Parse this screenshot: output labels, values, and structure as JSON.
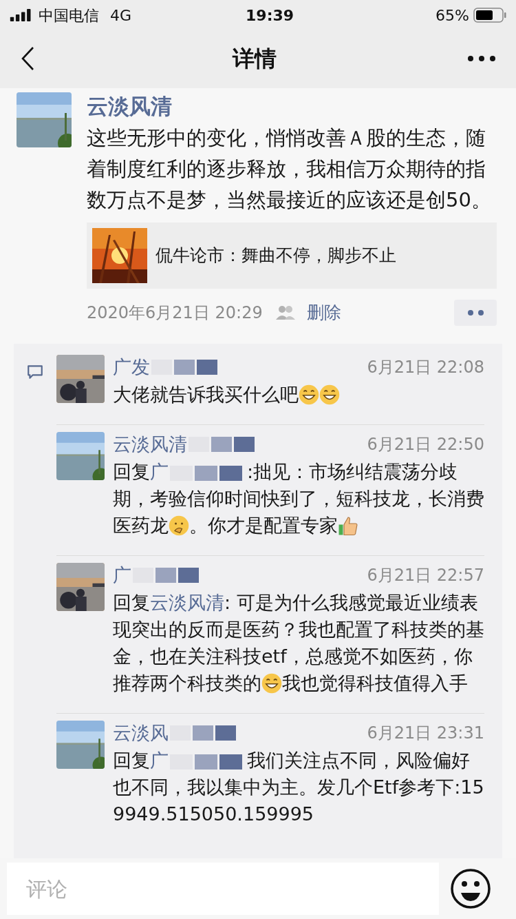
{
  "status_bar": {
    "carrier": "中国电信",
    "network": "4G",
    "time": "19:39",
    "battery": "65%"
  },
  "nav": {
    "title": "详情"
  },
  "post": {
    "author": "云淡风清",
    "text": "这些无形中的变化，悄悄改善Ａ股的生态，随着制度红利的逐步释放，我相信万众期待的指数万点不是梦，当然最接近的应该还是创50。",
    "link": {
      "title": "侃牛论市：舞曲不停，脚步不止"
    },
    "time": "2020年6月21日 20:29",
    "delete": "删除"
  },
  "comments": [
    {
      "author": "广发",
      "redacted": true,
      "time": "6月21日 22:08",
      "segments": [
        {
          "kind": "text",
          "text": "大佬就告诉我买什么吧"
        },
        {
          "kind": "grin"
        },
        {
          "kind": "grin"
        }
      ]
    },
    {
      "author": "云淡风清",
      "redacted": true,
      "time": "6月21日 22:50",
      "reply_label": "回复",
      "reply_to": "广",
      "reply_redacted": true,
      "segments": [
        {
          "kind": "text",
          "text": ":拙见：市场纠结震荡分歧期，考验信仰时间快到了，短科技龙，长消费医药龙"
        },
        {
          "kind": "thinking"
        },
        {
          "kind": "text",
          "text": "。你才是配置专家"
        },
        {
          "kind": "thumbs"
        }
      ]
    },
    {
      "author": "广",
      "redacted": true,
      "time": "6月21日 22:57",
      "reply_label": "回复",
      "reply_to": "云淡风清",
      "segments": [
        {
          "kind": "text",
          "text": ": 可是为什么我感觉最近业绩表现突出的反而是医药？我也配置了科技类的基金，也在关注科技etf，总感觉不如医药，你推荐两个科技类的"
        },
        {
          "kind": "grin"
        },
        {
          "kind": "text",
          "text": "我也觉得科技值得入手"
        }
      ]
    },
    {
      "author": "云淡风",
      "redacted": true,
      "time": "6月21日 23:31",
      "reply_label": "回复",
      "reply_to": "广",
      "reply_redacted": true,
      "segments": [
        {
          "kind": "text",
          "text": "我们关注点不同，风险偏好也不同，我以集中为主。发几个Etf参考下:159949.515050.159995"
        }
      ]
    }
  ],
  "comment_bar": {
    "placeholder": "评论"
  }
}
